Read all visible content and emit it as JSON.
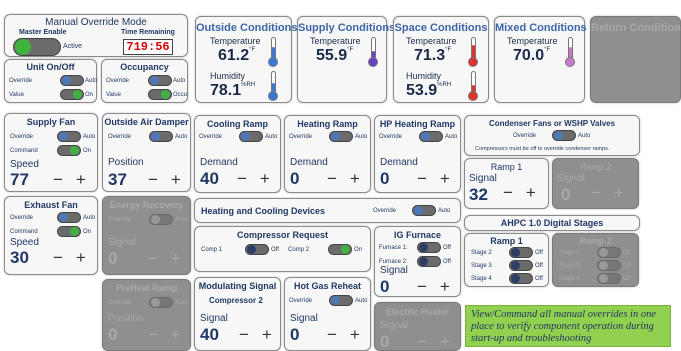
{
  "manual_override": {
    "title": "Manual Override Mode",
    "master_enable": "Master Enable",
    "time_remaining": "Time Remaining",
    "active": "Active",
    "timer": "719:56"
  },
  "unit_onoff": {
    "title": "Unit On/Off",
    "override": "Override",
    "auto": "Auto",
    "value": "Value",
    "on": "On"
  },
  "occupancy": {
    "title": "Occupancy",
    "override": "Override",
    "auto": "Auto",
    "value": "Value",
    "occ": "Occu"
  },
  "conditions": [
    {
      "title": "Outside Conditions",
      "temp_label": "Temperature",
      "temp": "61.2",
      "temp_unit": "°F",
      "hum_label": "Humidity",
      "hum": "78.1",
      "hum_unit": "%RH",
      "color": "#3a78d8"
    },
    {
      "title": "Supply Conditions",
      "temp_label": "Temperature",
      "temp": "55.9",
      "temp_unit": "°F",
      "color": "#6a3fc2"
    },
    {
      "title": "Space Conditions",
      "temp_label": "Temperature",
      "temp": "71.3",
      "temp_unit": "°F",
      "hum_label": "Humidity",
      "hum": "53.9",
      "hum_unit": "%RH",
      "color": "#e03030"
    },
    {
      "title": "Mixed Conditions",
      "temp_label": "Temperature",
      "temp": "70.0",
      "temp_unit": "°F",
      "color": "#c878c8"
    },
    {
      "title": "Return Conditions"
    }
  ],
  "supply_fan": {
    "title": "Supply Fan",
    "override": "Override",
    "auto": "Auto",
    "command": "Command",
    "on": "On",
    "speed_label": "Speed",
    "speed": "77"
  },
  "outside_air_damper": {
    "title": "Outside Air Damper",
    "override": "Override",
    "auto": "Auto",
    "pos_label": "Position",
    "pos": "37"
  },
  "exhaust_fan": {
    "title": "Exhaust Fan",
    "override": "Override",
    "auto": "Auto",
    "command": "Command",
    "on": "On",
    "speed_label": "Speed",
    "speed": "30"
  },
  "energy_recovery": {
    "title": "Energy Recovery",
    "override": "Override",
    "auto": "Auto",
    "signal_label": "Signal",
    "signal": "0"
  },
  "preheat_ramp": {
    "title": "PreHeat Ramp",
    "override": "Override",
    "auto": "Auto",
    "pos_label": "Position",
    "pos": "0"
  },
  "cooling_ramp": {
    "title": "Cooling Ramp",
    "override": "Override",
    "auto": "Auto",
    "demand_label": "Demand",
    "demand": "40"
  },
  "heating_ramp": {
    "title": "Heating Ramp",
    "override": "Override",
    "auto": "Auto",
    "demand_label": "Demand",
    "demand": "0"
  },
  "hp_heating_ramp": {
    "title": "HP Heating Ramp",
    "override": "Override",
    "auto": "Auto",
    "demand_label": "Demand",
    "demand": "0"
  },
  "heat_cool_devices": {
    "title": "Heating and Cooling Devices",
    "override": "Override",
    "auto": "Auto"
  },
  "compressor_request": {
    "title": "Compressor Request",
    "comp1": "Comp 1",
    "off": "Off",
    "comp2": "Comp 2",
    "on": "On"
  },
  "ig_furnace": {
    "title": "IG Furnace",
    "f1": "Furnace 1:",
    "f2": "Furnace 2:",
    "off": "Off",
    "signal_label": "Signal",
    "signal": "0"
  },
  "modulating_signal": {
    "title": "Modulating Signal",
    "sub": "Compressor 2",
    "signal_label": "Signal",
    "signal": "40"
  },
  "hot_gas_reheat": {
    "title": "Hot Gas Reheat",
    "override": "Override",
    "auto": "Auto",
    "signal_label": "Signal",
    "signal": "0"
  },
  "electric_heater": {
    "title": "Electric Heater",
    "signal_label": "Signal",
    "signal": "0"
  },
  "condenser": {
    "title": "Condenser Fans or WSHP Valves",
    "override": "Override",
    "auto": "Auto",
    "note": "Compressors must be off to override condenser ramps.",
    "ramp1": "Ramp 1",
    "ramp2": "Ramp 2",
    "signal_label": "Signal",
    "signal1": "32",
    "signal2": "0"
  },
  "ahpc": {
    "title": "AHPC 1.0 Digital Stages",
    "ramp1": "Ramp 1",
    "ramp2": "Ramp 2",
    "stage2": "Stage 2",
    "stage3": "Stage 3",
    "stage4": "Stage 4",
    "off": "Off"
  },
  "pm_symbols": "−+",
  "info_note": "View/Command all manual overrides in one place to verify component operation during start-up and troubleshooting"
}
